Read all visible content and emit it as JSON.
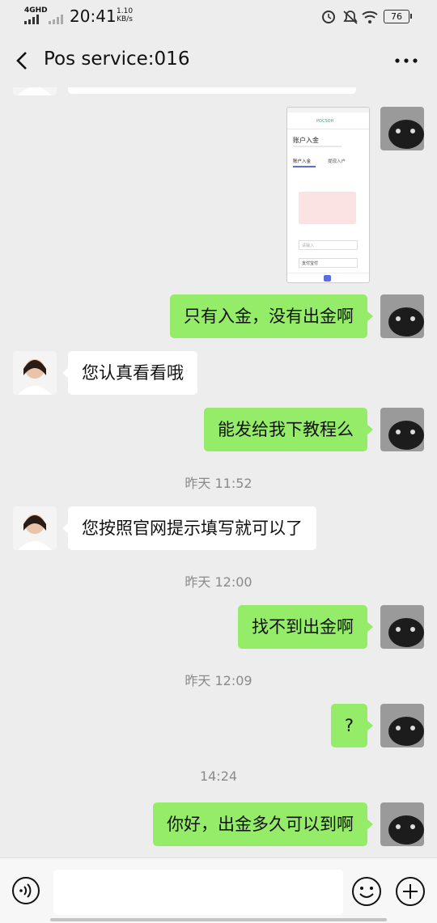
{
  "status_bar": {
    "network": "4GHD",
    "time": "20:41",
    "speed_value": "1.10",
    "speed_unit": "KB/s",
    "battery": "76"
  },
  "header": {
    "title": "Pos service:016"
  },
  "messages": [
    {
      "side": "right",
      "type": "image"
    },
    {
      "side": "right",
      "type": "text",
      "text": "只有入金，没有出金啊"
    },
    {
      "side": "left",
      "type": "text",
      "text": "您认真看看哦"
    },
    {
      "side": "right",
      "type": "text",
      "text": "能发给我下教程么"
    },
    {
      "type": "time",
      "text": "昨天 11:52"
    },
    {
      "side": "left",
      "type": "text",
      "text": "您按照官网提示填写就可以了"
    },
    {
      "type": "time",
      "text": "昨天 12:00"
    },
    {
      "side": "right",
      "type": "text",
      "text": "找不到出金啊"
    },
    {
      "type": "time",
      "text": "昨天 12:09"
    },
    {
      "side": "right",
      "type": "text",
      "text": "?"
    },
    {
      "type": "time",
      "text": "14:24"
    },
    {
      "side": "right",
      "type": "text",
      "text": "你好，出金多久可以到啊"
    }
  ],
  "screenshot_thumb": {
    "brand": "POCSOH",
    "title": "账户入金",
    "tab1": "账户入金",
    "tab2": "提现入户",
    "input_placeholder": "请输入",
    "select_value": "支付宝付"
  },
  "colors": {
    "bubble_green": "#95ec69",
    "background": "#ededed"
  }
}
